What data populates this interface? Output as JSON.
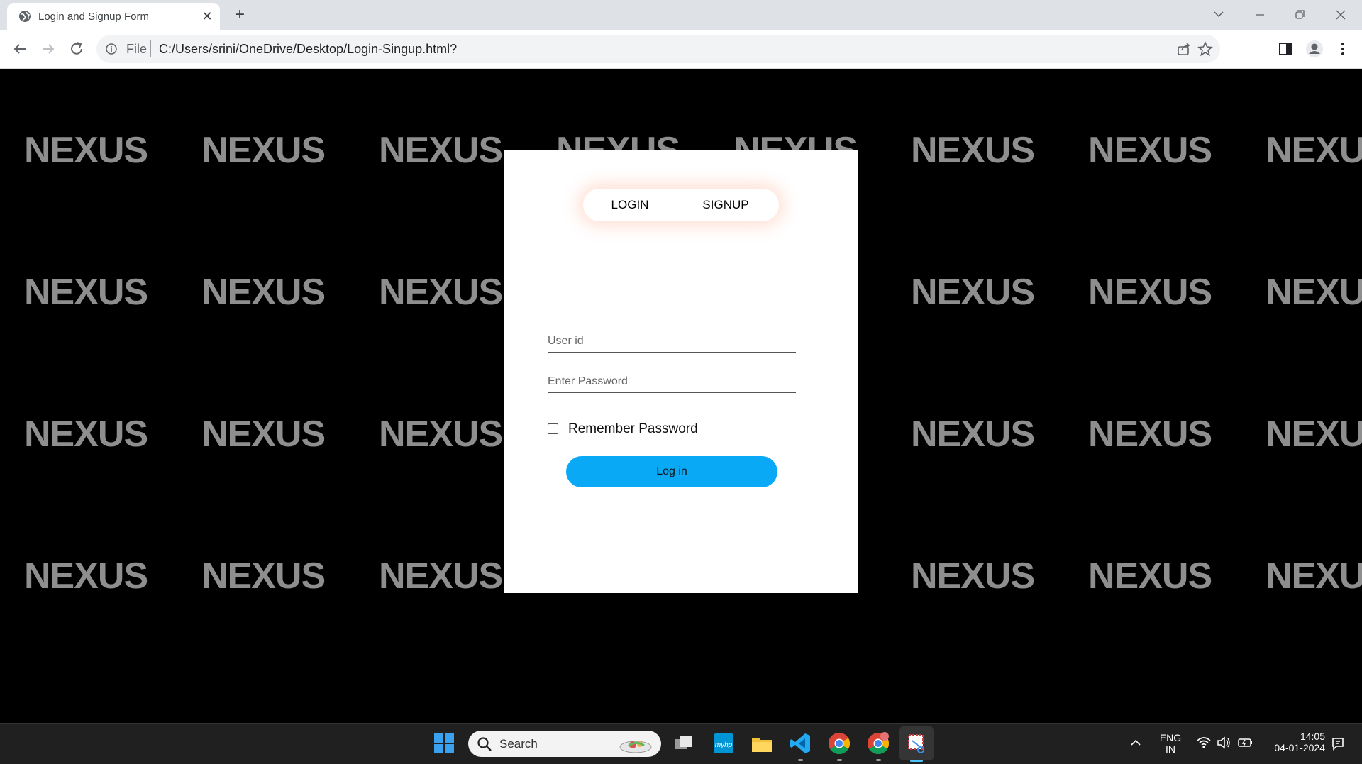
{
  "browser": {
    "tab_title": "Login and Signup Form",
    "tab_close": "✕",
    "new_tab": "+",
    "url_scheme": "File",
    "url": "C:/Users/srini/OneDrive/Desktop/Login-Singup.html?"
  },
  "watermark": {
    "text": "NEXUS",
    "color": "#8e8e8e"
  },
  "form": {
    "tabs": [
      "LOGIN",
      "SIGNUP"
    ],
    "userid_placeholder": "User id",
    "password_placeholder": "Enter Password",
    "remember_label": "Remember Password",
    "login_button": "Log in",
    "accent_color": "#0aa9f5"
  },
  "taskbar": {
    "search_label": "Search",
    "lang_top": "ENG",
    "lang_bottom": "IN",
    "time": "14:05",
    "date": "04-01-2024"
  }
}
